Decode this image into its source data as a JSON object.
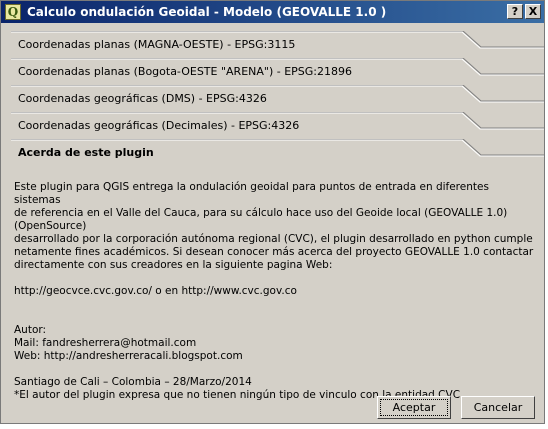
{
  "window": {
    "title": "Calculo ondulación Geoidal - Modelo (GEOVALLE 1.0 )",
    "icon": "qgis-icon",
    "icon_glyph": "Q",
    "help_label": "?",
    "close_label": "X"
  },
  "sections": [
    {
      "label": "Coordenadas planas (MAGNA-OESTE) - EPSG:3115",
      "active": false
    },
    {
      "label": "Coordenadas planas (Bogota-OESTE \"ARENA\") - EPSG:21896",
      "active": false
    },
    {
      "label": "Coordenadas geográficas (DMS) - EPSG:4326",
      "active": false
    },
    {
      "label": "Coordenadas geográficas (Decimales)  - EPSG:4326",
      "active": false
    },
    {
      "label": "Acerda de este plugin",
      "active": true
    }
  ],
  "about": {
    "intro": "Este plugin para QGIS entrega la ondulación geoidal para puntos de entrada en diferentes sistemas\nde referencia en  el Valle del Cauca, para su cálculo hace uso del Geoide local (GEOVALLE 1.0) (OpenSource)\ndesarrollado por la corporación autónoma regional (CVC), el plugin desarrollado en python cumple\nnetamente fines académicos. Si desean conocer más acerca del proyecto GEOVALLE 1.0 contactar\ndirectamente con sus creadores en la siguiente pagina Web:",
    "links": "http://geocvce.cvc.gov.co/  o en http://www.cvc.gov.co",
    "author_heading": "Autor:",
    "mail": "Mail: fandresherrera@hotmail.com",
    "web": "Web:  http://andresherreracali.blogspot.com",
    "place_date": "Santiago de Cali – Colombia – 28/Marzo/2014",
    "disclaimer": " *El autor del plugin expresa que no tienen ningún tipo de vinculo con la entidad CVC."
  },
  "buttons": {
    "accept": "Aceptar",
    "cancel": "Cancelar"
  }
}
